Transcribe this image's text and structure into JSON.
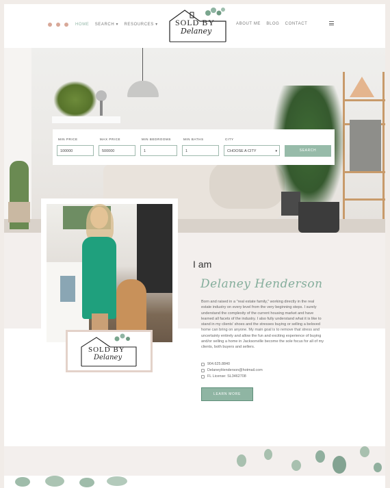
{
  "header": {
    "social_icons": [
      "facebook-icon",
      "instagram-icon",
      "linkedin-icon"
    ],
    "nav_left": [
      {
        "label": "HOME",
        "active": true
      },
      {
        "label": "SEARCH ▾",
        "active": false
      },
      {
        "label": "RESOURCES ▾",
        "active": false
      }
    ],
    "nav_right": [
      {
        "label": "ABOUT ME"
      },
      {
        "label": "BLOG"
      },
      {
        "label": "CONTACT"
      }
    ],
    "logo": {
      "line1": "SOLD BY",
      "line2": "Delaney"
    }
  },
  "search": {
    "fields": [
      {
        "label": "MIN PRICE",
        "value": "100000"
      },
      {
        "label": "MAX PRICE",
        "value": "500000"
      },
      {
        "label": "MIN BEDROOMS",
        "value": "1"
      },
      {
        "label": "MIN BATHS",
        "value": "1"
      },
      {
        "label": "CITY",
        "value": "CHOOSE A CITY"
      }
    ],
    "button": "SEARCH"
  },
  "about": {
    "intro": "I am",
    "name": "Delaney Henderson",
    "bio": "Born and raised in a \"real estate family,\" working directly in the real estate industry on every level from the very beginning steps. I surely understand the complexity of the current housing market and have learned all facets of the industry. I also fully understand what it is like to stand in my clients' shoes and the stresses buying or selling a beloved home can bring on anyone. My main goal is to remove that stress and uncertainty entirely and allow the fun and exciting experience of buying and/or selling a home in Jacksonville become the sole focus for all of my clients, both buyers and sellers.",
    "phone": "904.625.8840",
    "email": "DelaneyHenderson@hotmail.com",
    "license": "FL License: SL3462708",
    "button": "LEARN MORE",
    "logo_card": {
      "line1": "SOLD BY",
      "line2": "Delaney"
    }
  },
  "colors": {
    "accent": "#8fb5a3",
    "blush": "#e3d2c9"
  }
}
